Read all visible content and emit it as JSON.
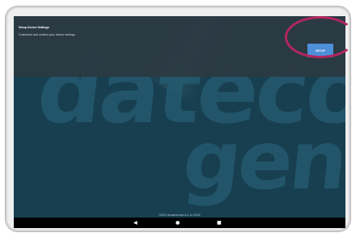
{
  "dialog": {
    "title": "Setup Device Settings",
    "subtitle": "Customize and confirm your device settings.",
    "button_label": "SETUP"
  },
  "watermark": {
    "line1": "datecod",
    "line2": "gen"
  },
  "footer": {
    "version": "OOG KioskHome A 1.0.OOG"
  },
  "navbar": {
    "back_icon": "◀",
    "home_icon": "●",
    "recent_icon": "■"
  },
  "colors": {
    "screen_bg": "#173f50",
    "dialog_bg": "#2d3a42",
    "button_bg": "#4d8fd9",
    "highlight": "#b1275e"
  }
}
